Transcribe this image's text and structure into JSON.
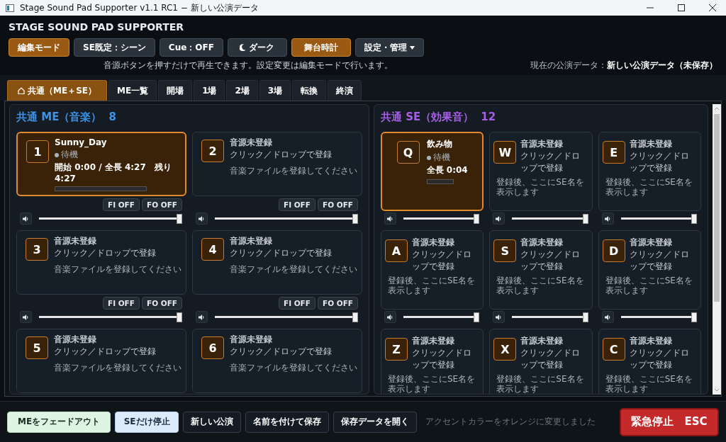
{
  "window": {
    "title": "Stage Sound Pad Supporter v1.1 RC1 − 新しい公演データ"
  },
  "app_title": "STAGE SOUND PAD SUPPORTER",
  "toolbar": [
    {
      "label": "編集モード",
      "on": true,
      "kind": "plain"
    },
    {
      "label": "SE既定：シーン",
      "on": false,
      "kind": "plain"
    },
    {
      "label": "Cue：OFF",
      "on": false,
      "kind": "plain"
    },
    {
      "label": "ダーク",
      "on": false,
      "kind": "theme"
    },
    {
      "label": "舞台時計",
      "on": true,
      "kind": "plain"
    },
    {
      "label": "設定・管理",
      "on": false,
      "kind": "menu"
    }
  ],
  "hint": "音源ボタンを押すだけで再生できます。設定変更は編集モードで行います。",
  "current_data": {
    "label": "現在の公演データ：",
    "value": "新しい公演データ（未保存）"
  },
  "tabs": [
    {
      "label": "共通（ME＋SE）",
      "selected": true,
      "kind": "home"
    },
    {
      "label": "ME一覧",
      "selected": false
    },
    {
      "label": "開場",
      "selected": false
    },
    {
      "label": "1場",
      "selected": false
    },
    {
      "label": "2場",
      "selected": false
    },
    {
      "label": "3場",
      "selected": false
    },
    {
      "label": "転換",
      "selected": false
    },
    {
      "label": "終演",
      "selected": false
    }
  ],
  "me": {
    "title": "共通 ME（音楽）",
    "count": "8",
    "pads": [
      {
        "key": "1",
        "kind": "loaded",
        "selected": true,
        "title": "Sunny_Day",
        "status": "待機",
        "time": "開始 0:00 / 全長 4:27　残り 4:27",
        "progress": {
          "level": 0
        },
        "fades": [
          "FI OFF",
          "FO OFF"
        ],
        "volume": {
          "level": 1
        }
      },
      {
        "key": "2",
        "kind": "empty",
        "selected": false,
        "title": "音源未登録",
        "sub": "クリック／ドロップで登録",
        "note": "音楽ファイルを登録してください",
        "fades": [
          "FI OFF",
          "FO OFF"
        ],
        "volume": {
          "level": 1
        }
      },
      {
        "key": "3",
        "kind": "empty",
        "selected": false,
        "title": "音源未登録",
        "sub": "クリック／ドロップで登録",
        "note": "音楽ファイルを登録してください",
        "fades": [
          "FI OFF",
          "FO OFF"
        ],
        "volume": {
          "level": 1
        }
      },
      {
        "key": "4",
        "kind": "empty",
        "selected": false,
        "title": "音源未登録",
        "sub": "クリック／ドロップで登録",
        "note": "音楽ファイルを登録してください",
        "fades": [
          "FI OFF",
          "FO OFF"
        ],
        "volume": {
          "level": 1
        }
      },
      {
        "key": "5",
        "kind": "empty",
        "selected": false,
        "title": "音源未登録",
        "sub": "クリック／ドロップで登録",
        "note": "音楽ファイルを登録してください"
      },
      {
        "key": "6",
        "kind": "empty",
        "selected": false,
        "title": "音源未登録",
        "sub": "クリック／ドロップで登録",
        "note": "音楽ファイルを登録してください"
      }
    ]
  },
  "se": {
    "title": "共通 SE（効果音）",
    "count": "12",
    "pads": [
      {
        "key": "Q",
        "kind": "loaded",
        "selected": true,
        "title": "飲み物",
        "status": "待機",
        "time": "全長 0:04",
        "progress": {
          "level": 0
        },
        "volume": {
          "level": 1
        }
      },
      {
        "key": "W",
        "kind": "empty",
        "selected": false,
        "title": "音源未登録",
        "sub": "クリック／ドロップで登録",
        "note": "登録後、ここにSE名を表示します",
        "volume": {
          "level": 1
        }
      },
      {
        "key": "E",
        "kind": "empty",
        "selected": false,
        "title": "音源未登録",
        "sub": "クリック／ドロップで登録",
        "note": "登録後、ここにSE名を表示します",
        "volume": {
          "level": 1
        }
      },
      {
        "key": "A",
        "kind": "empty",
        "selected": false,
        "title": "音源未登録",
        "sub": "クリック／ドロップで登録",
        "note": "登録後、ここにSE名を表示します",
        "volume": {
          "level": 1
        }
      },
      {
        "key": "S",
        "kind": "empty",
        "selected": false,
        "title": "音源未登録",
        "sub": "クリック／ドロップで登録",
        "note": "登録後、ここにSE名を表示します",
        "volume": {
          "level": 1
        }
      },
      {
        "key": "D",
        "kind": "empty",
        "selected": false,
        "title": "音源未登録",
        "sub": "クリック／ドロップで登録",
        "note": "登録後、ここにSE名を表示します",
        "volume": {
          "level": 1
        }
      },
      {
        "key": "Z",
        "kind": "empty",
        "selected": false,
        "title": "音源未登録",
        "sub": "クリック／ドロップで登録",
        "note": "登録後、ここにSE名を表示します"
      },
      {
        "key": "X",
        "kind": "empty",
        "selected": false,
        "title": "音源未登録",
        "sub": "クリック／ドロップで登録",
        "note": "登録後、ここにSE名を表示します"
      },
      {
        "key": "C",
        "kind": "empty",
        "selected": false,
        "title": "音源未登録",
        "sub": "クリック／ドロップで登録",
        "note": "登録後、ここにSE名を表示します"
      }
    ]
  },
  "bottom_bar": {
    "buttons": [
      {
        "label": "MEをフェードアウト",
        "kind": "fade"
      },
      {
        "label": "SEだけ停止",
        "kind": "stop"
      },
      {
        "label": "新しい公演",
        "kind": "plain"
      },
      {
        "label": "名前を付けて保存",
        "kind": "plain"
      },
      {
        "label": "保存データを開く",
        "kind": "plain"
      }
    ],
    "message": "アクセントカラーをオレンジに変更しました",
    "emergency": "緊急停止　ESC"
  }
}
